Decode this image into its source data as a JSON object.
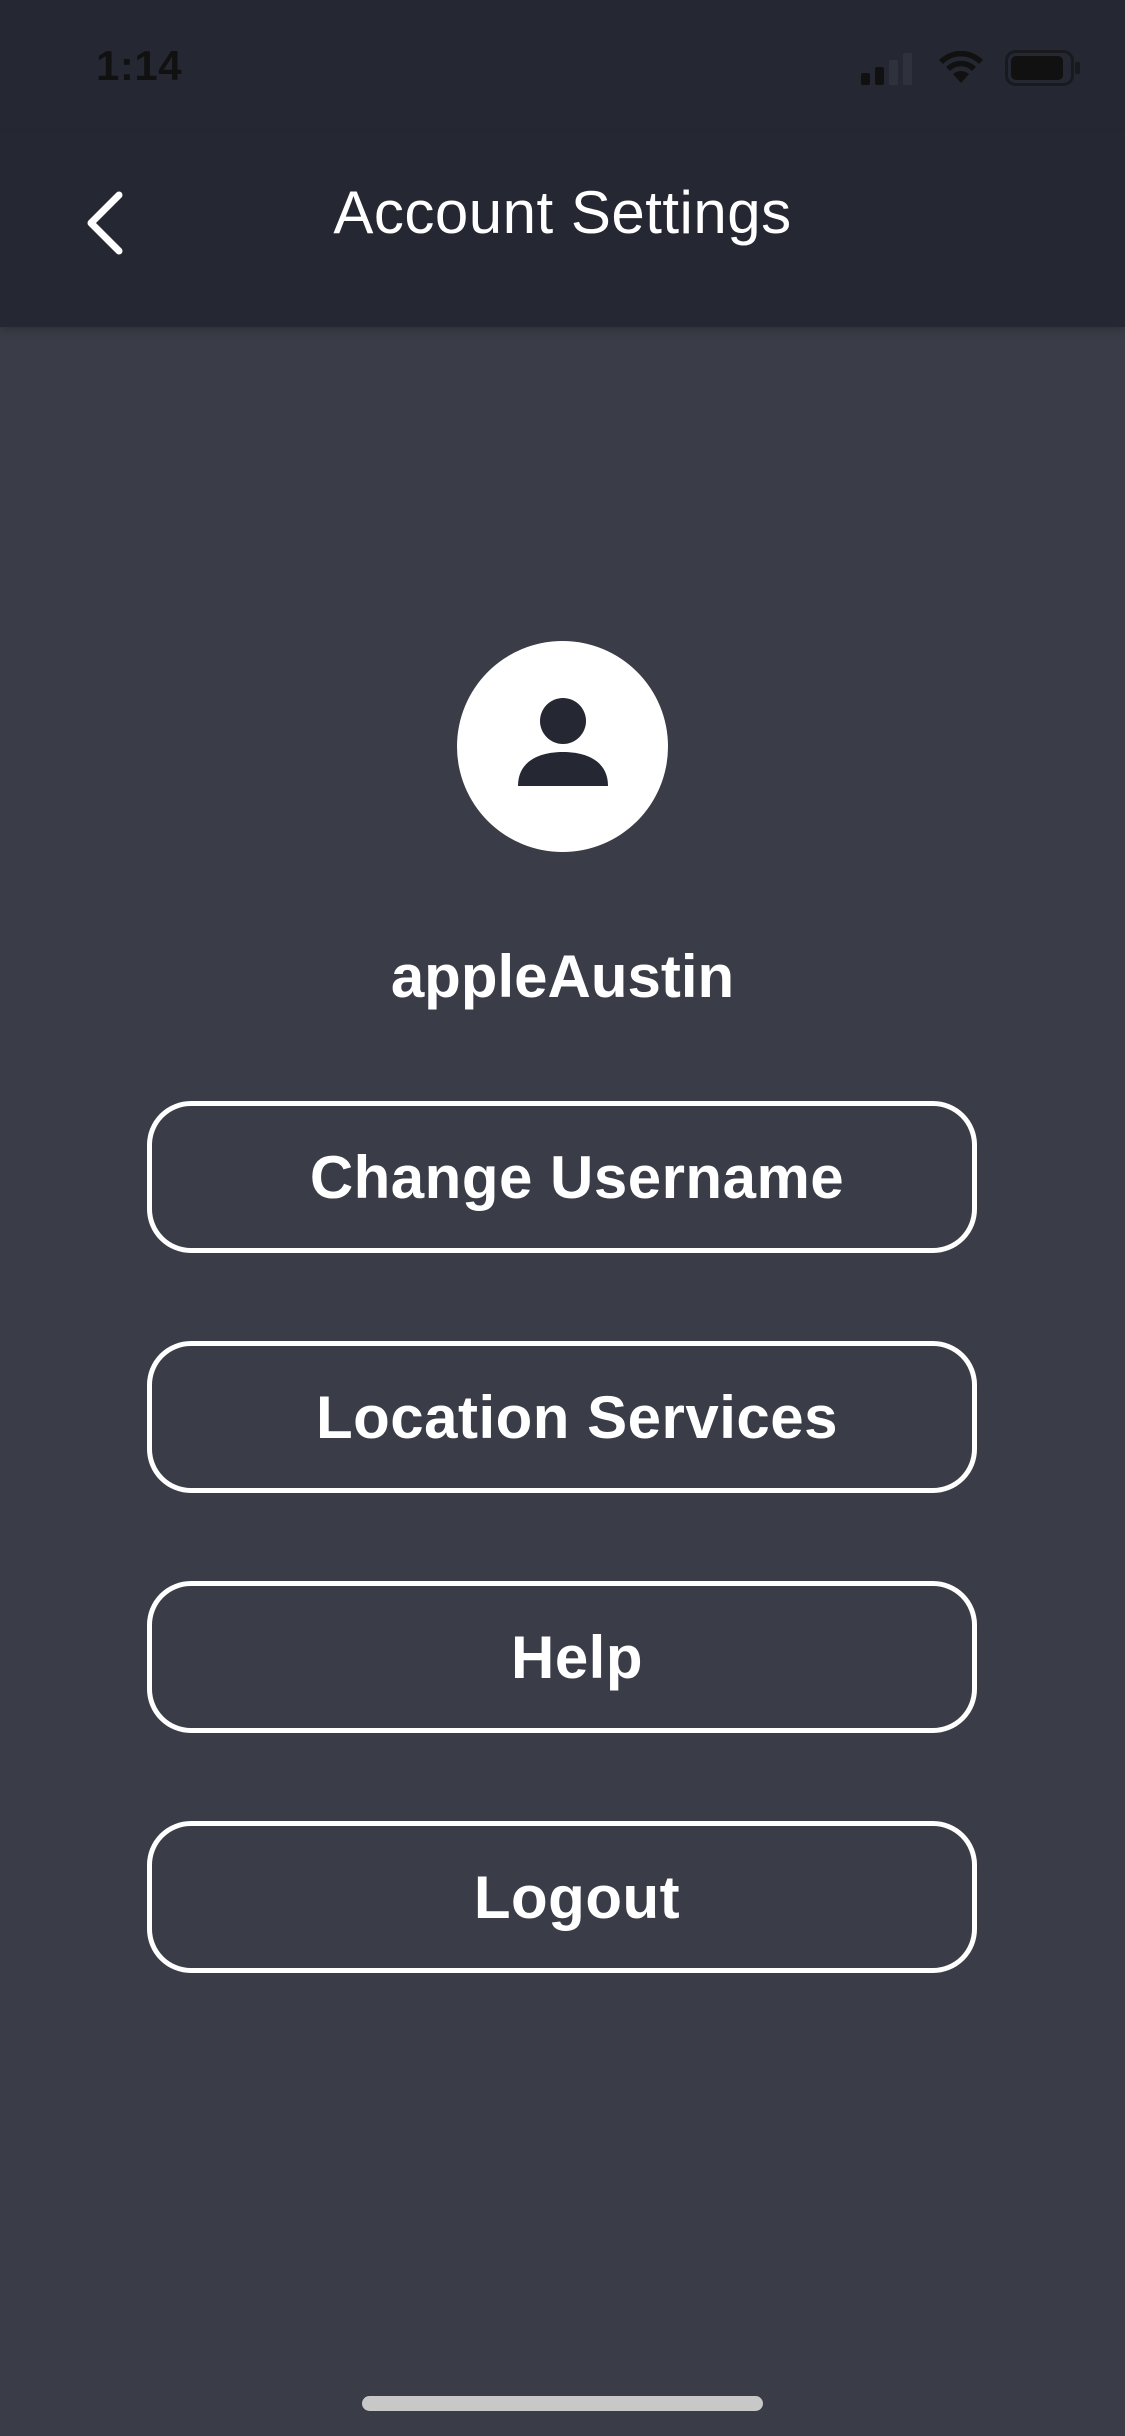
{
  "status_bar": {
    "time": "1:14",
    "icons": [
      "cellular-signal-icon",
      "wifi-icon",
      "battery-icon"
    ]
  },
  "header": {
    "back_icon": "chevron-left-icon",
    "title": "Account Settings"
  },
  "profile": {
    "avatar_icon": "user-icon",
    "username": "appleAustin"
  },
  "menu": {
    "items": [
      {
        "label": "Change Username"
      },
      {
        "label": "Location Services"
      },
      {
        "label": "Help"
      },
      {
        "label": "Logout"
      }
    ]
  },
  "colors": {
    "background": "#3a3c47",
    "header_background": "#252833",
    "text": "#ffffff",
    "button_border": "#ffffff"
  }
}
